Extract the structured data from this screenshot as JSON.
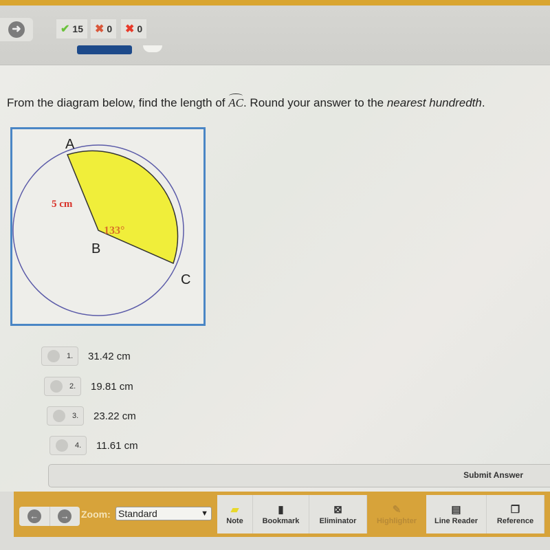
{
  "header": {
    "scores": [
      {
        "icon": "check-icon",
        "glyph": "✔",
        "color": "#6ac23b",
        "value": "15"
      },
      {
        "icon": "partial-x-icon",
        "glyph": "✖",
        "color": "#d9573a",
        "value": "0"
      },
      {
        "icon": "x-icon",
        "glyph": "✖",
        "color": "#e83a2a",
        "value": "0"
      }
    ],
    "next_glyph": "➜"
  },
  "question": {
    "prefix": "From the diagram below, find the length of ",
    "arc_label": "AC",
    "middle": ". Round your answer to the ",
    "emphasis": "nearest hundredth",
    "suffix": "."
  },
  "diagram": {
    "point_a": "A",
    "point_b": "B",
    "point_c": "C",
    "radius_label": "5 cm",
    "angle_label": "133°",
    "colors": {
      "sector": "#f0ee3a",
      "circle": "#5a5aa8",
      "radius_label": "#d8322a",
      "angle_label": "#d8702a",
      "border": "#4a86c5"
    }
  },
  "choices": [
    {
      "number": "1.",
      "text": "31.42 cm"
    },
    {
      "number": "2.",
      "text": "19.81 cm"
    },
    {
      "number": "3.",
      "text": "23.22 cm"
    },
    {
      "number": "4.",
      "text": "11.61 cm"
    }
  ],
  "submit_label": "Submit Answer",
  "footer": {
    "zoom_label": "Zoom:",
    "zoom_value": "Standard",
    "tools": [
      {
        "label": "Note",
        "glyph": "▰"
      },
      {
        "label": "Bookmark",
        "glyph": "🔖"
      },
      {
        "label": "Eliminator",
        "glyph": "⊠"
      },
      {
        "label": "Highlighter",
        "glyph": "✎"
      },
      {
        "label": "Line Reader",
        "glyph": "▤"
      },
      {
        "label": "Reference",
        "glyph": "❐"
      }
    ]
  }
}
